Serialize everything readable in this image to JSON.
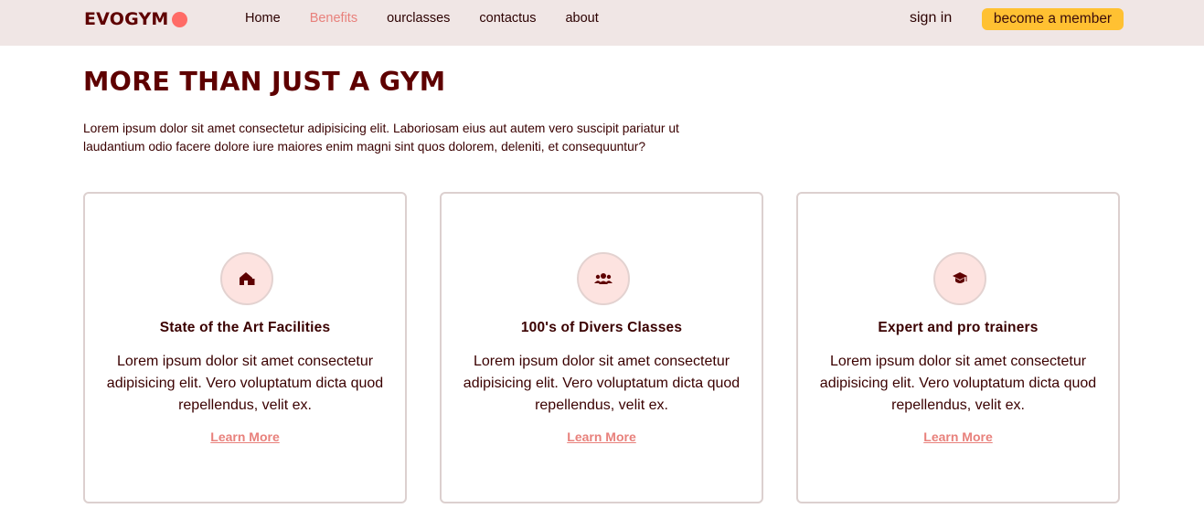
{
  "nav": {
    "logo_text": "EVOGYM",
    "links": [
      {
        "label": "Home",
        "active": false
      },
      {
        "label": "Benefits",
        "active": true
      },
      {
        "label": "ourclasses",
        "active": false
      },
      {
        "label": "contactus",
        "active": false
      },
      {
        "label": "about",
        "active": false
      }
    ],
    "signin_label": "sign in",
    "member_label": "become a member"
  },
  "hero": {
    "title": "MORE THAN JUST A GYM",
    "intro": "Lorem ipsum dolor sit amet consectetur adipisicing elit. Laboriosam eius aut autem vero suscipit pariatur ut laudantium odio facere dolore iure maiores enim magni sint quos dolorem, deleniti, et consequuntur?"
  },
  "cards": [
    {
      "icon": "home-icon",
      "title": "State of the Art Facilities",
      "text": "Lorem ipsum dolor sit amet consectetur adipisicing elit. Vero voluptatum dicta quod repellendus, velit ex.",
      "link": "Learn More"
    },
    {
      "icon": "users-icon",
      "title": "100's of Divers Classes",
      "text": "Lorem ipsum dolor sit amet consectetur adipisicing elit. Vero voluptatum dicta quod repellendus, velit ex.",
      "link": "Learn More"
    },
    {
      "icon": "graduation-cap-icon",
      "title": "Expert and pro trainers",
      "text": "Lorem ipsum dolor sit amet consectetur adipisicing elit. Vero voluptatum dicta quod repellendus, velit ex.",
      "link": "Learn More"
    }
  ],
  "colors": {
    "navbar_bg": "#f0e6e5",
    "brand_dark": "#5e0000",
    "accent": "#ff6b66",
    "link_active": "#e8817c",
    "button_bg": "#ffc132",
    "icon_bg": "#fde3e0"
  }
}
